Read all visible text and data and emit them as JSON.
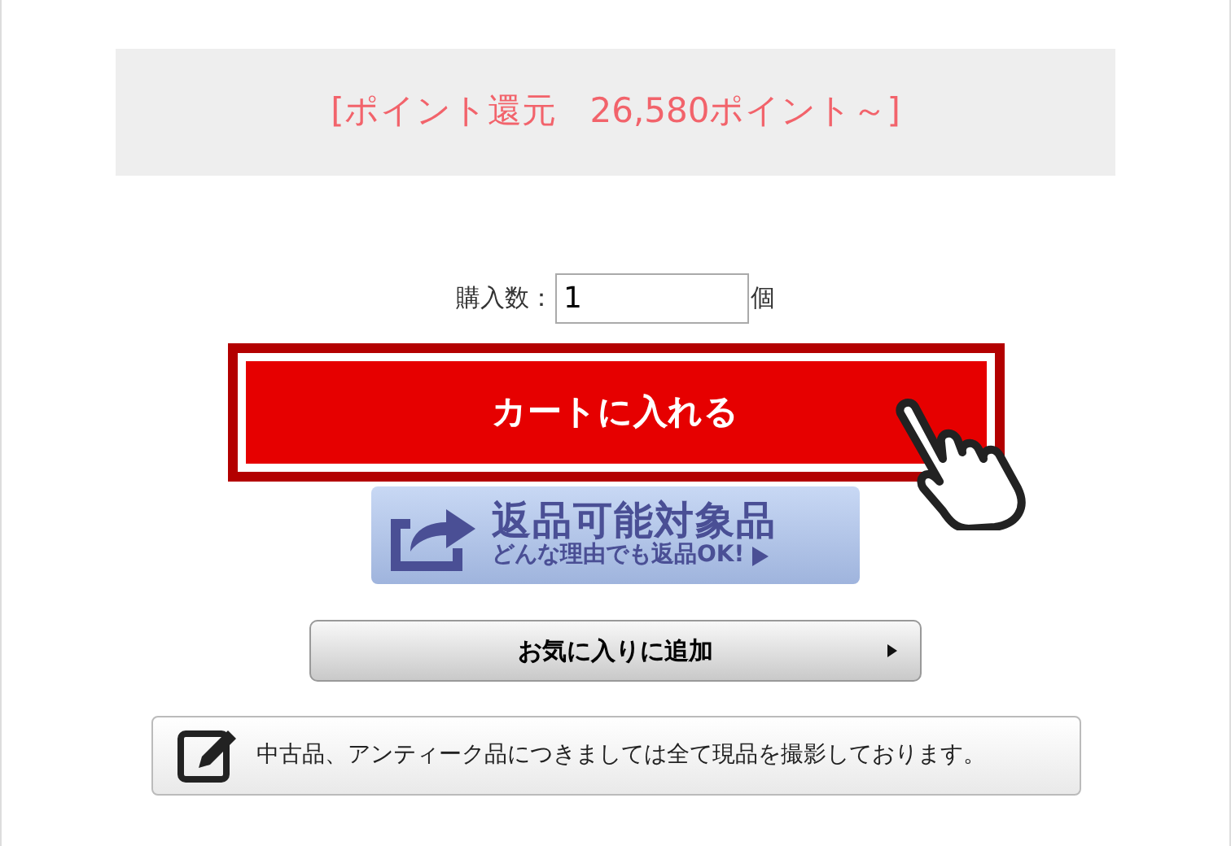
{
  "point_banner": {
    "text": "[ポイント還元　26,580ポイント～]"
  },
  "quantity": {
    "label": "購入数：",
    "value": "1",
    "unit": "個"
  },
  "cart_button": {
    "label": "カートに入れる"
  },
  "returns_banner": {
    "title": "返品可能対象品",
    "subtitle": "どんな理由でも返品OK!"
  },
  "favorite_button": {
    "label": "お気に入りに追加"
  },
  "notice": {
    "text": "中古品、アンティーク品につきましては全て現品を撮影しております。"
  }
}
